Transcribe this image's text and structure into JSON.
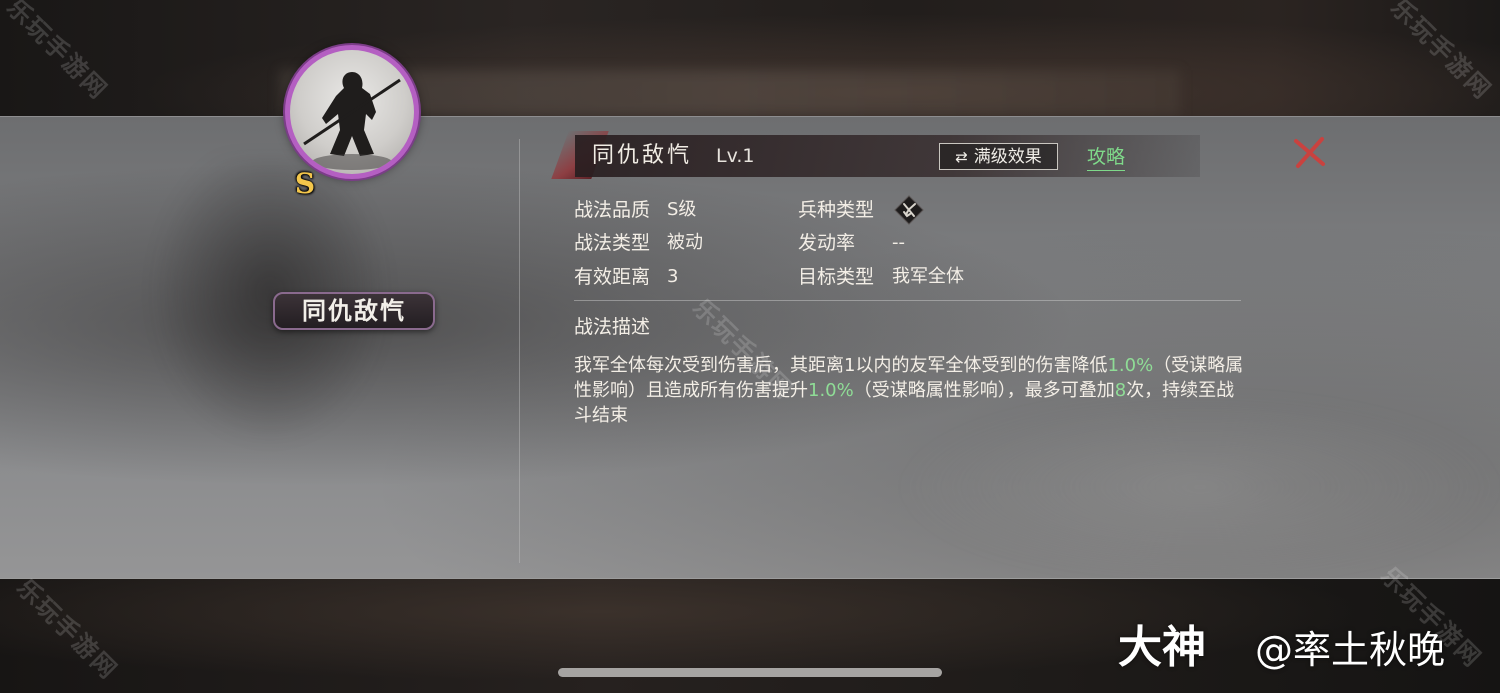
{
  "skill": {
    "name": "同仇敌忾",
    "level": "Lv.1",
    "grade_badge": "S",
    "max_effect_label": "满级效果",
    "strategy_link": "攻略"
  },
  "attributes": {
    "quality_label": "战法品质",
    "quality_value": "S级",
    "type_label": "战法类型",
    "type_value": "被动",
    "range_label": "有效距离",
    "range_value": "3",
    "troop_label": "兵种类型",
    "trigger_label": "发动率",
    "trigger_value": "--",
    "target_label": "目标类型",
    "target_value": "我军全体"
  },
  "description": {
    "title": "战法描述",
    "part1": "我军全体每次受到伤害后，其距离1以内的友军全体受到的伤害降低",
    "hl1": "1.0%",
    "part2": "（受谋略属性影响）且造成所有伤害提升",
    "hl2": "1.0%",
    "part3": "（受谋略属性影响），最多可叠加",
    "hl3": "8",
    "part4": "次，持续至战斗结束"
  },
  "overlay": {
    "watermark_text": "乐玩手游网",
    "brand": "大神",
    "user": "@率土秋晚"
  },
  "colors": {
    "highlight_green": "#8fdc96",
    "portrait_ring": "#b45fc2",
    "grade_gold": "#f3c64b",
    "close_red": "#c9423f"
  },
  "icons": {
    "troop_type": "troop-type-icon",
    "close": "close-icon",
    "swap": "swap-icon"
  }
}
